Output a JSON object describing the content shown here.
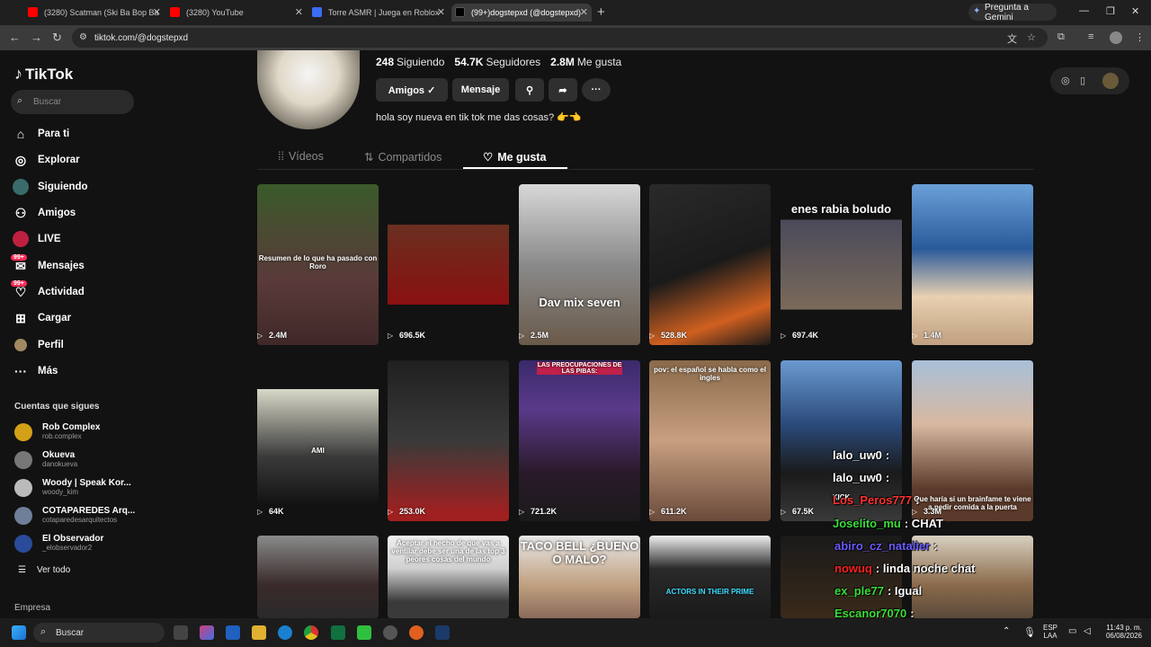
{
  "browser": {
    "tabs": [
      {
        "title": "(3280) Scatman (Ski Ba Bop Ba",
        "favicon_color": "#ff0000"
      },
      {
        "title": "(3280) YouTube",
        "favicon_color": "#ff0000"
      },
      {
        "title": "Torre ASMR | Juega en Roblox",
        "favicon_color": "#3a6cf4"
      },
      {
        "title": "(99+)dogstepxd (@dogstepxd)",
        "favicon_color": "#000000"
      }
    ],
    "gemini_label": "Pregunta a Gemini",
    "url": "tiktok.com/@dogstepxd"
  },
  "sidebar": {
    "logo": "TikTok",
    "search_placeholder": "Buscar",
    "nav": [
      {
        "label": "Para ti",
        "icon": "home-icon"
      },
      {
        "label": "Explorar",
        "icon": "compass-icon"
      },
      {
        "label": "Siguiendo",
        "icon": "following-icon"
      },
      {
        "label": "Amigos",
        "icon": "friends-icon"
      },
      {
        "label": "LIVE",
        "icon": "live-icon"
      },
      {
        "label": "Mensajes",
        "icon": "messages-icon",
        "badge": "99+"
      },
      {
        "label": "Actividad",
        "icon": "activity-icon",
        "badge": "99+"
      },
      {
        "label": "Cargar",
        "icon": "upload-icon"
      },
      {
        "label": "Perfil",
        "icon": "profile-icon"
      },
      {
        "label": "Más",
        "icon": "more-icon"
      }
    ],
    "following_title": "Cuentas que sigues",
    "accounts": [
      {
        "name": "Rob Complex",
        "handle": "rob.complex",
        "color": "#d4a017"
      },
      {
        "name": "Okueva",
        "handle": "danokueva",
        "color": "#777777"
      },
      {
        "name": "Woody | Speak Kor...",
        "handle": "woody_kim",
        "color": "#bbbbbb"
      },
      {
        "name": "COTAPAREDES Arq...",
        "handle": "cotaparedesarquitectos",
        "color": "#6f7f9a"
      },
      {
        "name": "El Observador",
        "handle": "_elobservador2",
        "color": "#2a4a9a"
      }
    ],
    "see_all": "Ver todo",
    "company": "Empresa"
  },
  "profile": {
    "following_count": "248",
    "following_label": "Siguiendo",
    "followers_count": "54.7K",
    "followers_label": "Seguidores",
    "likes_count": "2.8M",
    "likes_label": "Me gusta",
    "friends_button": "Amigos ✓",
    "message_button": "Mensaje",
    "bio": "hola soy nueva en tik tok me das cosas? 👉👈",
    "tabs": {
      "videos": "Vídeos",
      "shared": "Compartidos",
      "liked": "Me gusta"
    }
  },
  "videos": [
    {
      "views": "2.4M",
      "caption": "Resumen de lo que ha pasado con Roro",
      "bg": "linear-gradient(180deg,#3a5a2a,#5a3a3a 60%,#402828)"
    },
    {
      "views": "696.5K",
      "caption": "",
      "bg": "linear-gradient(180deg,#121212 0,#121212 25%,#6a3020 25%,#8a1010 75%,#121212 75%)"
    },
    {
      "views": "2.5M",
      "caption": "Dav mix seven",
      "bg": "linear-gradient(180deg,#d8d8d8,#8a8a8a 50%,#6a5a4a)"
    },
    {
      "views": "528.8K",
      "caption": "",
      "bg": "linear-gradient(160deg,#2a2a2a,#1a1a1a 50%,#d06020 80%,#1a1a1a)"
    },
    {
      "views": "697.4K",
      "caption": "enes rabia boludo",
      "bg": "linear-gradient(180deg,#121212 0,#121212 22%,#4a4a5a 22%,#7a6a5a 78%,#121212 78%)"
    },
    {
      "views": "1.4M",
      "caption": "",
      "bg": "linear-gradient(180deg,#6aa0d8,#2a5a9a 40%,#e8d0b0 70%,#c0a080)"
    },
    {
      "views": "64K",
      "caption": "AMI",
      "bg": "linear-gradient(180deg,#121212 0,#121212 18%,#d8d8c8 18%,#3a3a3a 60%,#121212 90%)"
    },
    {
      "views": "253.0K",
      "caption": "",
      "bg": "linear-gradient(180deg,#202020,#3a3a3a 50%,#a02020 95%)"
    },
    {
      "views": "721.2K",
      "caption": "LAS PREOCUPACIONES DE LAS PIBAS:",
      "bg": "linear-gradient(180deg,#3a2a6a,#5a3a8a 30%,#2a1a2a 70%,#1a1a1a)"
    },
    {
      "views": "611.2K",
      "caption": "pov: el español se habla como el ingles",
      "bg": "linear-gradient(180deg,#8a6a4a,#c8a080 50%,#6a4a3a)"
    },
    {
      "views": "67.5K",
      "caption": "KICK",
      "bg": "linear-gradient(180deg,#6a9ad0,#2a4a7a 40%,#1a1a1a 70%,#3a3a3a)"
    },
    {
      "views": "3.3M",
      "caption": "Que haría si un brainfame te viene a pedir comida a la puerta",
      "bg": "linear-gradient(180deg,#a8c0d8,#d8b8a0 40%,#5a3a2a 80%)"
    },
    {
      "views": "",
      "caption": "",
      "bg": "linear-gradient(180deg,#8a8a8a,#3a2a2a 60%,#2a2a2a)"
    },
    {
      "views": "",
      "caption": "Aceptar el hecho de que vas a ventilar debe ser una de las top 3 peores cosas del mundo",
      "bg": "linear-gradient(180deg,#f0f0f0,#d0d0d0 40%,#3a3a3a 80%)"
    },
    {
      "views": "",
      "caption": "TACO BELL ¿BUENO O MALO?",
      "bg": "linear-gradient(180deg,#e8e8e8,#c0a080 60%,#8a6a5a)"
    },
    {
      "views": "",
      "caption": "ACTORS IN THEIR PRIME",
      "bg": "linear-gradient(180deg,#f0f0f0,#2a2a2a 40%,#1a1a1a)"
    },
    {
      "views": "",
      "caption": "",
      "bg": "linear-gradient(180deg,#1a1a1a,#3a2a1a)"
    },
    {
      "views": "",
      "caption": "",
      "bg": "linear-gradient(180deg,#d8d0c0,#8a6a4a 60%,#5a4a3a)"
    }
  ],
  "chat": [
    {
      "user": "lalo_uw0",
      "text": ":",
      "color": "#ffffff"
    },
    {
      "user": "lalo_uw0",
      "text": ":",
      "color": "#ffffff"
    },
    {
      "user": "Los_Peros777",
      "text": ":",
      "color": "#ff3030"
    },
    {
      "user": "Joselito_mu",
      "text": ": CHAT",
      "color": "#3adc3a"
    },
    {
      "user": "abiro_cz_natalier",
      "text": ":",
      "color": "#6a5aff"
    },
    {
      "user": "nowuq",
      "text": ": linda noche chat",
      "color": "#ff2020"
    },
    {
      "user": "ex_ple77",
      "text": ": Igual",
      "color": "#3adc3a"
    },
    {
      "user": "Escanor7070",
      "text": ":",
      "color": "#3adc3a"
    }
  ],
  "taskbar": {
    "search": "Buscar",
    "lang": "ESP",
    "lang2": "LAA",
    "time": "11:43 p. m.",
    "date": "06/08/2026"
  }
}
